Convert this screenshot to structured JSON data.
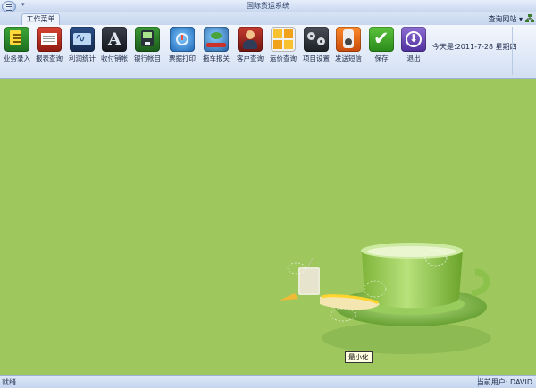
{
  "window": {
    "title": "国际货运系统"
  },
  "tabs": [
    {
      "label": "工作菜单",
      "active": true
    }
  ],
  "header_link": {
    "label": "查询网站",
    "arrow": "▾"
  },
  "toolbar": {
    "buttons": [
      {
        "label": "业务录入",
        "icon": "ledger-icon"
      },
      {
        "label": "报表查询",
        "icon": "report-icon"
      },
      {
        "label": "利润统计",
        "icon": "chart-icon"
      },
      {
        "label": "收付销帐",
        "icon": "payment-icon"
      },
      {
        "label": "银行帐目",
        "icon": "bank-icon"
      },
      {
        "label": "票据打印",
        "icon": "print-icon"
      },
      {
        "label": "拖车报关",
        "icon": "customs-icon"
      },
      {
        "label": "客户查询",
        "icon": "client-icon"
      },
      {
        "label": "运价查询",
        "icon": "freight-icon"
      },
      {
        "label": "项目设置",
        "icon": "settings-icon"
      },
      {
        "label": "发送短信",
        "icon": "sms-icon"
      },
      {
        "label": "保存",
        "icon": "save-icon"
      },
      {
        "label": "退出",
        "icon": "exit-icon"
      }
    ],
    "date_prefix": "今天是:",
    "date_value": "2011-7-28",
    "weekday": "星期四"
  },
  "workspace": {
    "tooltip": "最小化"
  },
  "statusbar": {
    "status": "就绪",
    "user_label": "当前用户:",
    "user_value": "DAVID"
  },
  "colors": {
    "workspace_bg": "#9ec85e",
    "ribbon_bg": "#e1eaf8",
    "accent": "#1e2b4a"
  }
}
